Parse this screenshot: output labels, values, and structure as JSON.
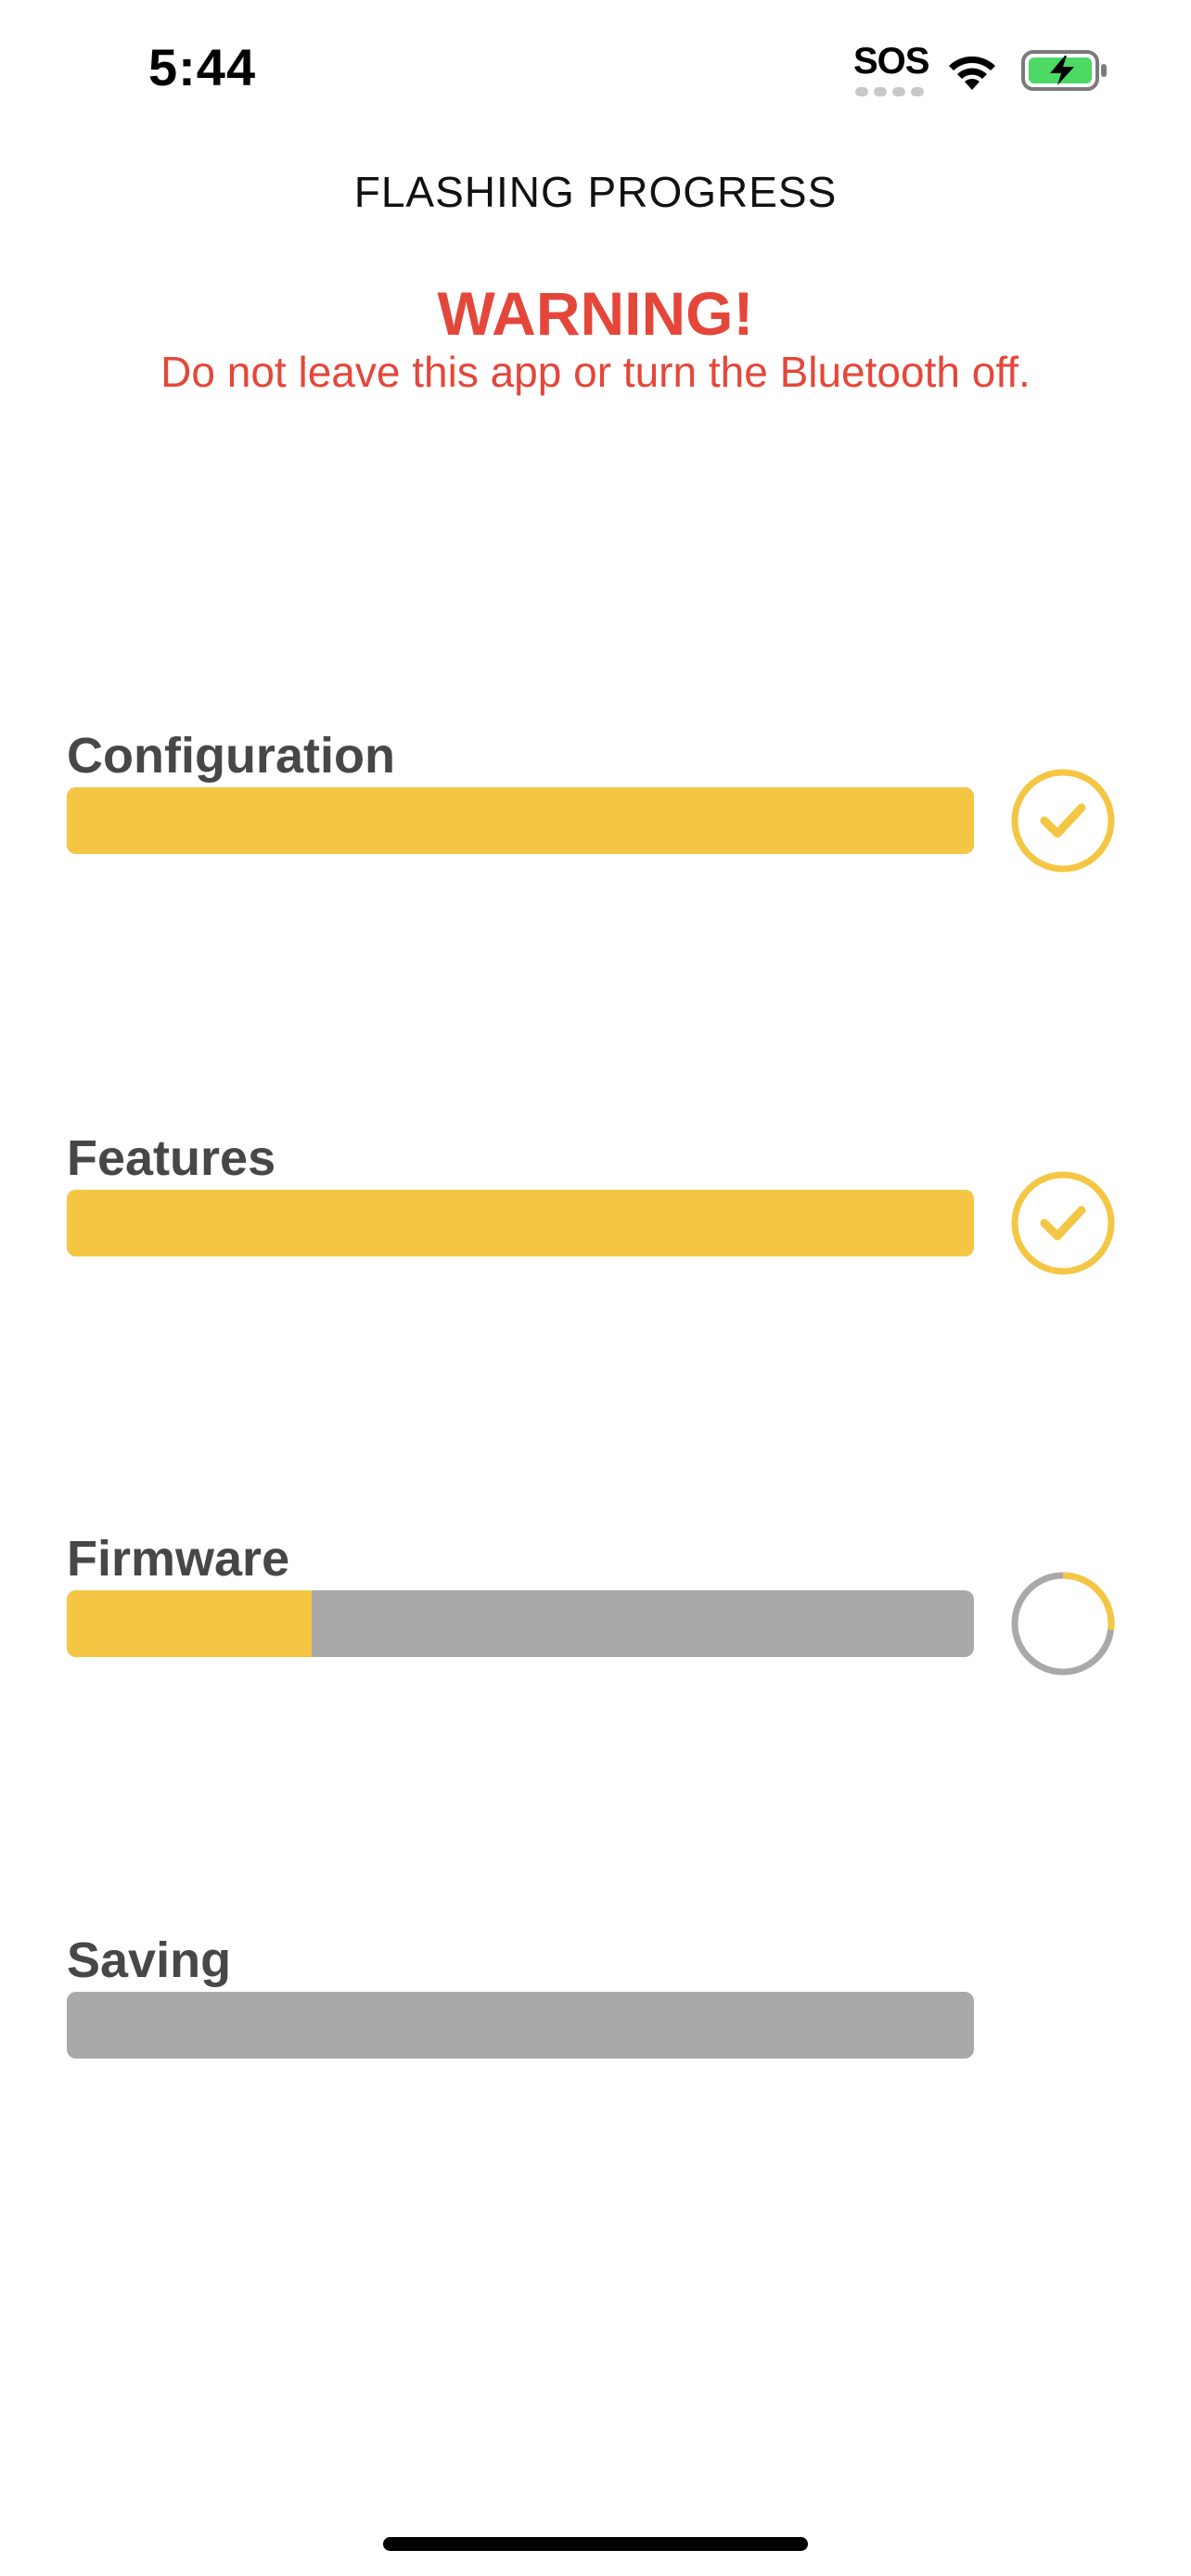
{
  "status_bar": {
    "time": "5:44",
    "carrier": "SOS",
    "wifi_icon": "wifi-icon",
    "battery_icon": "battery-charging-icon",
    "battery_color": "#4cd964"
  },
  "header": {
    "title": "FLASHING PROGRESS"
  },
  "warning": {
    "title": "WARNING!",
    "text": "Do not leave this app or turn the Bluetooth off.",
    "color": "#e4473a"
  },
  "colors": {
    "accent": "#f5c644",
    "track": "#a9a9a9",
    "label": "#474747"
  },
  "steps": [
    {
      "label": "Configuration",
      "progress": 1.0,
      "status": "complete",
      "status_icon": "checkmark-circle-icon"
    },
    {
      "label": "Features",
      "progress": 1.0,
      "status": "complete",
      "status_icon": "checkmark-circle-icon"
    },
    {
      "label": "Firmware",
      "progress": 0.27,
      "status": "in-progress",
      "status_icon": "progress-ring-icon"
    },
    {
      "label": "Saving",
      "progress": 0.0,
      "status": "pending",
      "status_icon": ""
    }
  ]
}
